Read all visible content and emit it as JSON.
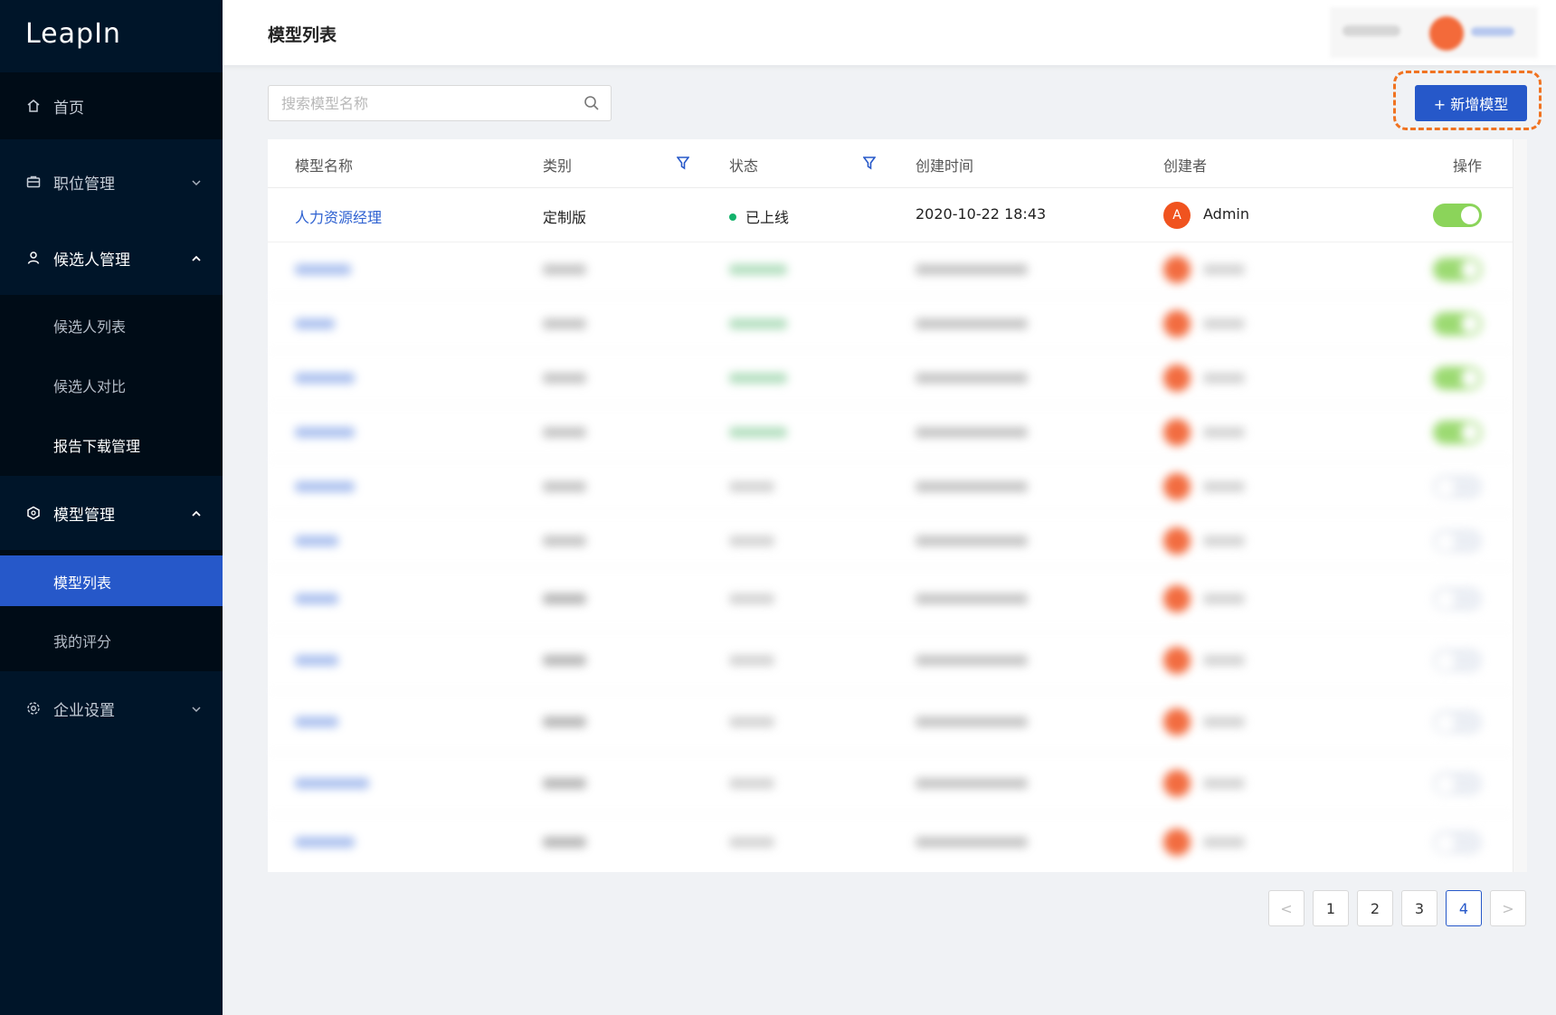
{
  "app": {
    "logo": "LeapIn"
  },
  "sidebar": {
    "items": [
      {
        "label": "首页",
        "icon": "home-icon"
      },
      {
        "label": "职位管理",
        "icon": "briefcase-icon",
        "chevron": "chevron-down-icon"
      },
      {
        "label": "候选人管理",
        "icon": "user-icon",
        "chevron": "chevron-up-icon"
      },
      {
        "label": "模型管理",
        "icon": "cube-icon",
        "chevron": "chevron-up-icon"
      },
      {
        "label": "企业设置",
        "icon": "settings-icon",
        "chevron": "chevron-down-icon"
      }
    ],
    "candidate_sub": [
      "候选人列表",
      "候选人对比",
      "报告下载管理"
    ],
    "model_sub": [
      "模型列表",
      "我的评分"
    ]
  },
  "header": {
    "title": "模型列表"
  },
  "search": {
    "placeholder": "搜索模型名称"
  },
  "toolbar": {
    "add_label": "+ 新增模型"
  },
  "table": {
    "columns": [
      "模型名称",
      "类别",
      "状态",
      "创建时间",
      "创建者",
      "操作"
    ],
    "first_row": {
      "name": "人力资源经理",
      "category": "定制版",
      "status": "已上线",
      "created": "2020-10-22 18:43",
      "creator": "Admin",
      "avatar_initial": "A",
      "enabled": true
    }
  },
  "pagination": {
    "pages": [
      "1",
      "2",
      "3",
      "4"
    ],
    "current": "4",
    "prev": "<",
    "next": ">"
  },
  "colors": {
    "sidebar_bg": "#001529",
    "primary": "#2658c9",
    "online": "#13b26b",
    "toggle_on": "#8bd45a",
    "avatar": "#f0531f",
    "highlight": "#f07321"
  }
}
